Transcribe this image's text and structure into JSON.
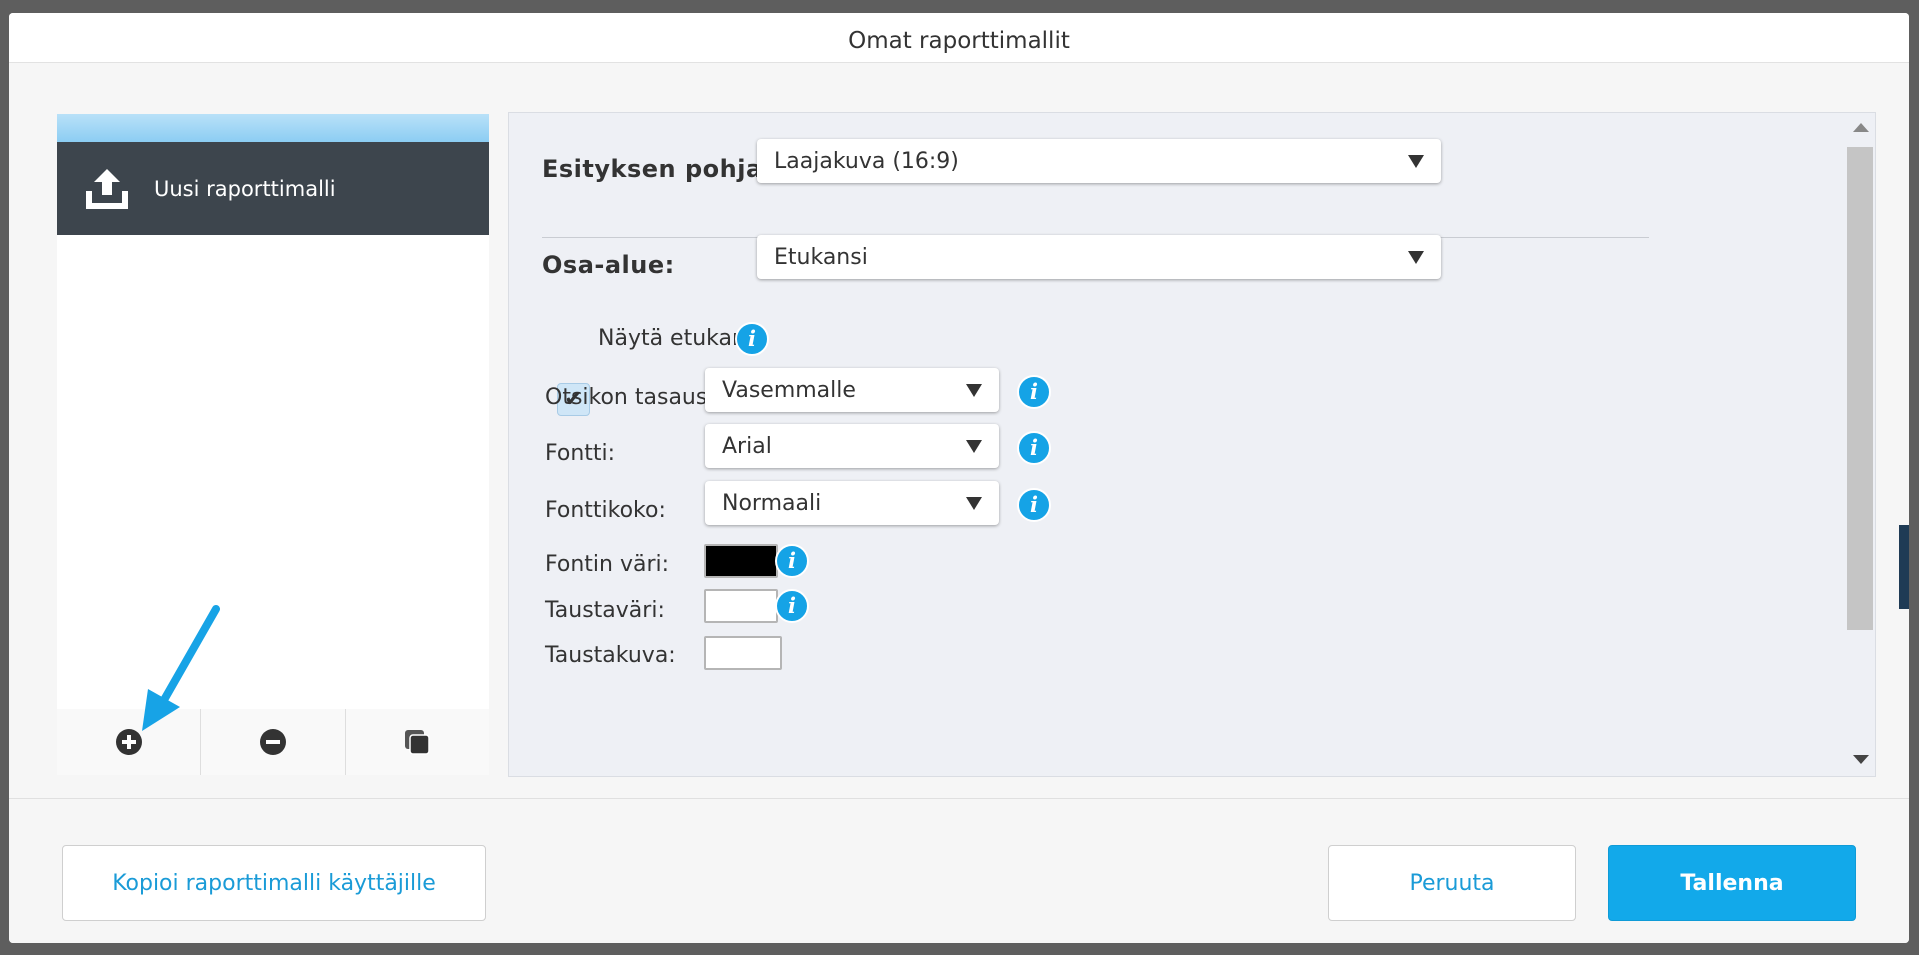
{
  "dialog": {
    "title": "Omat raporttimallit"
  },
  "templates": {
    "items": [
      {
        "label": "Uusi raporttimalli",
        "icon": "upload-icon"
      }
    ],
    "toolbar": [
      {
        "icon": "plus-circle-icon"
      },
      {
        "icon": "minus-circle-icon"
      },
      {
        "icon": "duplicate-icon"
      }
    ]
  },
  "settings": {
    "presentation_base": {
      "label": "Esityksen pohja:",
      "value": "Laajakuva (16:9)"
    },
    "section": {
      "label": "Osa-alue:",
      "value": "Etukansi"
    },
    "show_cover": {
      "label": "Näytä etukansi",
      "checked": true
    },
    "title_alignment": {
      "label": "Otsikon tasaus:",
      "value": "Vasemmalle"
    },
    "font": {
      "label": "Fontti:",
      "value": "Arial"
    },
    "font_size": {
      "label": "Fonttikoko:",
      "value": "Normaali"
    },
    "font_color": {
      "label": "Fontin väri:",
      "color": "#000000"
    },
    "background_color": {
      "label": "Taustaväri:",
      "color": "#ffffff"
    },
    "background_image": {
      "label": "Taustakuva:"
    }
  },
  "footer": {
    "copy_label": "Kopioi raporttimalli käyttäjille",
    "cancel_label": "Peruuta",
    "save_label": "Tallenna"
  },
  "colors": {
    "accent": "#12a9ea",
    "header_dark": "#3d454d",
    "info": "#15a3e6"
  }
}
